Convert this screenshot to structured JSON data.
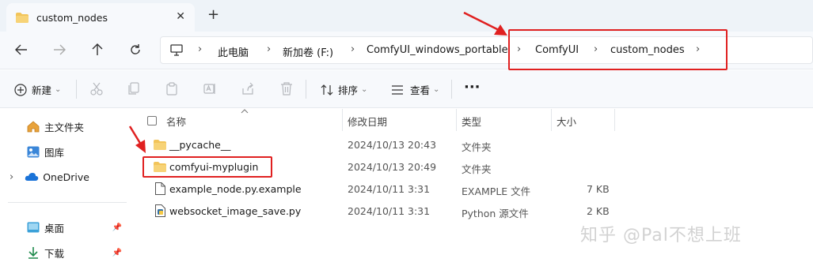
{
  "window": {
    "tab_title": "custom_nodes",
    "close_glyph": "✕",
    "new_tab_glyph": "+"
  },
  "address_bar": {
    "crumbs": [
      "此电脑",
      "新加卷 (F:)",
      "ComfyUI_windows_portable",
      "ComfyUI",
      "custom_nodes"
    ],
    "separator": "›"
  },
  "command_bar": {
    "new_label": "新建",
    "sort_label": "排序",
    "view_label": "查看",
    "more_glyph": "···",
    "dropdown_glyph": "⌄"
  },
  "nav_pane": {
    "items": [
      {
        "label": "主文件夹",
        "icon": "home-icon"
      },
      {
        "label": "图库",
        "icon": "gallery-icon"
      },
      {
        "label": "OneDrive",
        "icon": "cloud-icon"
      },
      {
        "label": "桌面",
        "icon": "desktop-icon"
      },
      {
        "label": "下载",
        "icon": "download-icon"
      }
    ]
  },
  "file_list": {
    "columns": [
      "名称",
      "修改日期",
      "类型",
      "大小"
    ],
    "rows": [
      {
        "name": "__pycache__",
        "modified": "2024/10/13 20:43",
        "type": "文件夹",
        "size": "",
        "icon": "folder-icon"
      },
      {
        "name": "comfyui-myplugin",
        "modified": "2024/10/13 20:49",
        "type": "文件夹",
        "size": "",
        "icon": "folder-icon"
      },
      {
        "name": "example_node.py.example",
        "modified": "2024/10/11 3:31",
        "type": "EXAMPLE 文件",
        "size": "7 KB",
        "icon": "file-icon"
      },
      {
        "name": "websocket_image_save.py",
        "modified": "2024/10/11 3:31",
        "type": "Python 源文件",
        "size": "2 KB",
        "icon": "python-file-icon"
      }
    ]
  },
  "watermark": "知乎 @Pal不想上班",
  "colors": {
    "highlight": "#e02020",
    "folder": "#f2c45a",
    "accent": "#2f6fd1"
  }
}
